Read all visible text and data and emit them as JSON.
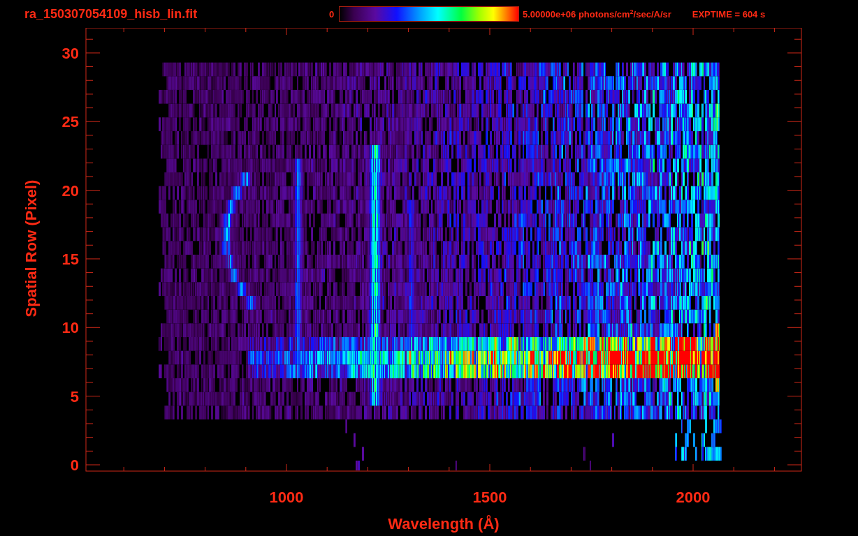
{
  "title": "ra_150307054109_hisb_lin.fit",
  "colorbar": {
    "min_label": "0",
    "max_label": "5.00000e+06 photons/cm$^{2}$/sec/A/sr"
  },
  "exposure": "EXPTIME = 604 s",
  "y_axis": {
    "label": "Spatial Row (Pixel)",
    "ticks": [
      "30",
      "25",
      "20",
      "15",
      "10",
      "5",
      "0"
    ]
  },
  "x_axis": {
    "label": "Wavelength (Å)",
    "ticks": [
      "1000",
      "1500",
      "2000"
    ]
  }
}
